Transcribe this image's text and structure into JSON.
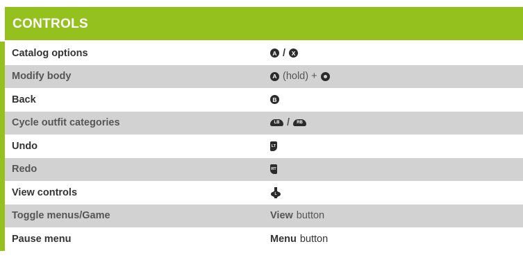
{
  "header": {
    "title": "CONTROLS"
  },
  "colors": {
    "accent": "#95c11f",
    "shade": "#d2d2d2"
  },
  "rows": [
    {
      "action": "Catalog options",
      "control": {
        "parts": [
          {
            "type": "button",
            "icon": "a-button-icon",
            "glyph": "A"
          },
          {
            "type": "text",
            "value": "/",
            "bold": true
          },
          {
            "type": "button",
            "icon": "x-button-icon",
            "glyph": "X"
          }
        ]
      }
    },
    {
      "action": "Modify body",
      "control": {
        "parts": [
          {
            "type": "button",
            "icon": "a-button-icon",
            "glyph": "A"
          },
          {
            "type": "text",
            "value": "(hold) +",
            "bold": false
          },
          {
            "type": "stick",
            "icon": "left-stick-icon"
          }
        ]
      }
    },
    {
      "action": "Back",
      "control": {
        "parts": [
          {
            "type": "button",
            "icon": "b-button-icon",
            "glyph": "B"
          }
        ]
      }
    },
    {
      "action": "Cycle outfit categories",
      "control": {
        "parts": [
          {
            "type": "bumper",
            "icon": "lb-bumper-icon",
            "glyph": "LB"
          },
          {
            "type": "text",
            "value": "/",
            "bold": true
          },
          {
            "type": "bumper",
            "icon": "rb-bumper-icon",
            "glyph": "RB"
          }
        ]
      }
    },
    {
      "action": "Undo",
      "control": {
        "parts": [
          {
            "type": "trigger-left",
            "icon": "lt-trigger-icon",
            "glyph": "LT"
          }
        ]
      }
    },
    {
      "action": "Redo",
      "control": {
        "parts": [
          {
            "type": "trigger-right",
            "icon": "rt-trigger-icon",
            "glyph": "RT"
          }
        ]
      }
    },
    {
      "action": "View controls",
      "control": {
        "parts": [
          {
            "type": "dpad",
            "icon": "left-stick-click-icon",
            "glyph": "L"
          }
        ]
      }
    },
    {
      "action": "Toggle menus/Game",
      "control": {
        "parts": [
          {
            "type": "text",
            "value": "View",
            "bold": true
          },
          {
            "type": "text",
            "value": "button",
            "bold": false
          }
        ]
      }
    },
    {
      "action": "Pause menu",
      "control": {
        "parts": [
          {
            "type": "text",
            "value": "Menu",
            "bold": true
          },
          {
            "type": "text",
            "value": "button",
            "bold": false
          }
        ]
      }
    }
  ]
}
